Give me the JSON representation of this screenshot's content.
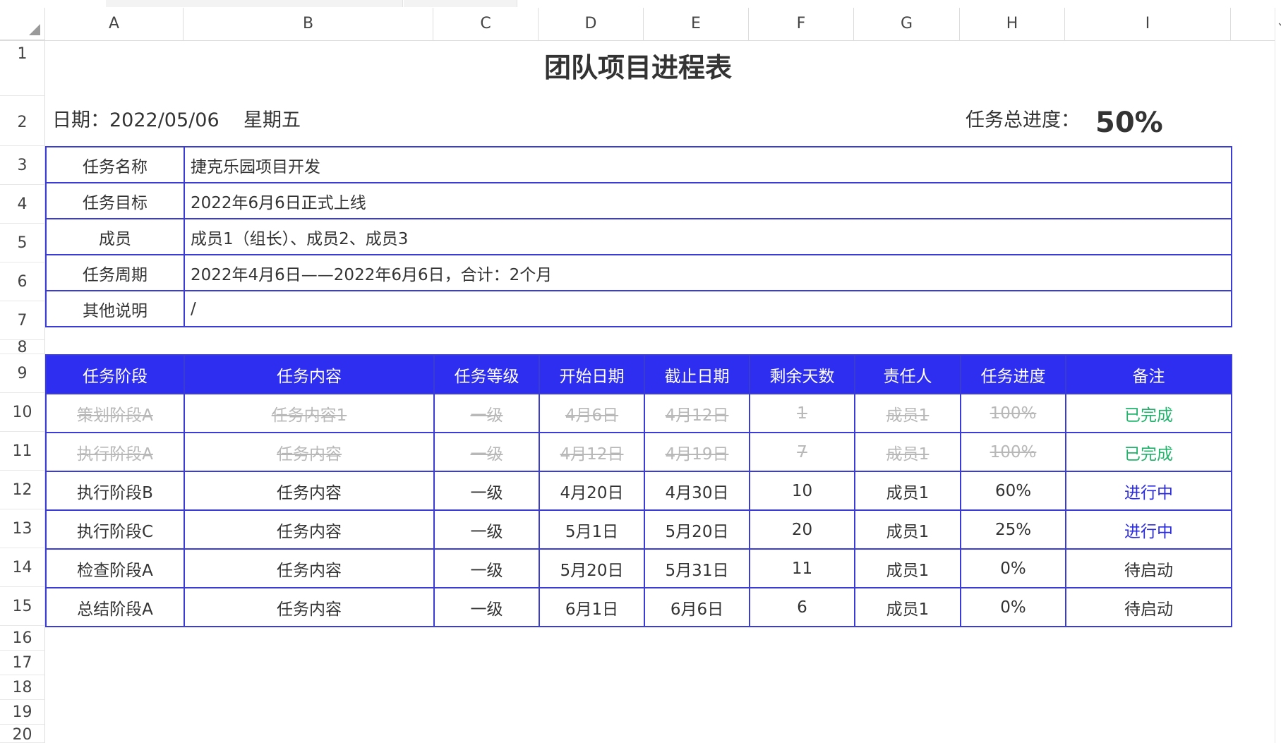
{
  "columns": [
    "A",
    "B",
    "C",
    "D",
    "E",
    "F",
    "G",
    "H",
    "I"
  ],
  "rows": [
    "1",
    "2",
    "3",
    "4",
    "5",
    "6",
    "7",
    "8",
    "9",
    "10",
    "11",
    "12",
    "13",
    "14",
    "15",
    "16",
    "17",
    "18",
    "19",
    "20"
  ],
  "title": "团队项目进程表",
  "date_line": "日期：2022/05/06    星期五",
  "progress_label": "任务总进度：",
  "progress_value": "50%",
  "info": [
    {
      "label": "任务名称",
      "value": "捷克乐园项目开发"
    },
    {
      "label": "任务目标",
      "value": "2022年6月6日正式上线"
    },
    {
      "label": "成员",
      "value": "成员1（组长）、成员2、成员3"
    },
    {
      "label": "任务周期",
      "value": "2022年4月6日——2022年6月6日，合计：2个月"
    },
    {
      "label": "其他说明",
      "value": "/"
    }
  ],
  "task_headers": [
    "任务阶段",
    "任务内容",
    "任务等级",
    "开始日期",
    "截止日期",
    "剩余天数",
    "责任人",
    "任务进度",
    "备注"
  ],
  "tasks": [
    {
      "stage": "策划阶段A",
      "content": "任务内容1",
      "level": "一级",
      "start": "4月6日",
      "end": "4月12日",
      "remaining": "1",
      "owner": "成员1",
      "progress": "100%",
      "note": "已完成",
      "status": "done"
    },
    {
      "stage": "执行阶段A",
      "content": "任务内容",
      "level": "一级",
      "start": "4月12日",
      "end": "4月19日",
      "remaining": "7",
      "owner": "成员1",
      "progress": "100%",
      "note": "已完成",
      "status": "done"
    },
    {
      "stage": "执行阶段B",
      "content": "任务内容",
      "level": "一级",
      "start": "4月20日",
      "end": "4月30日",
      "remaining": "10",
      "owner": "成员1",
      "progress": "60%",
      "note": "进行中",
      "status": "progress"
    },
    {
      "stage": "执行阶段C",
      "content": "任务内容",
      "level": "一级",
      "start": "5月1日",
      "end": "5月20日",
      "remaining": "20",
      "owner": "成员1",
      "progress": "25%",
      "note": "进行中",
      "status": "progress"
    },
    {
      "stage": "检查阶段A",
      "content": "任务内容",
      "level": "一级",
      "start": "5月20日",
      "end": "5月31日",
      "remaining": "11",
      "owner": "成员1",
      "progress": "0%",
      "note": "待启动",
      "status": "pending"
    },
    {
      "stage": "总结阶段A",
      "content": "任务内容",
      "level": "一级",
      "start": "6月1日",
      "end": "6月6日",
      "remaining": "6",
      "owner": "成员1",
      "progress": "0%",
      "note": "待启动",
      "status": "pending"
    }
  ],
  "colors": {
    "header_bg": "#2e2ef0",
    "border": "#3b3bd6",
    "done": "#21b36b",
    "in_progress": "#2b2be0"
  }
}
